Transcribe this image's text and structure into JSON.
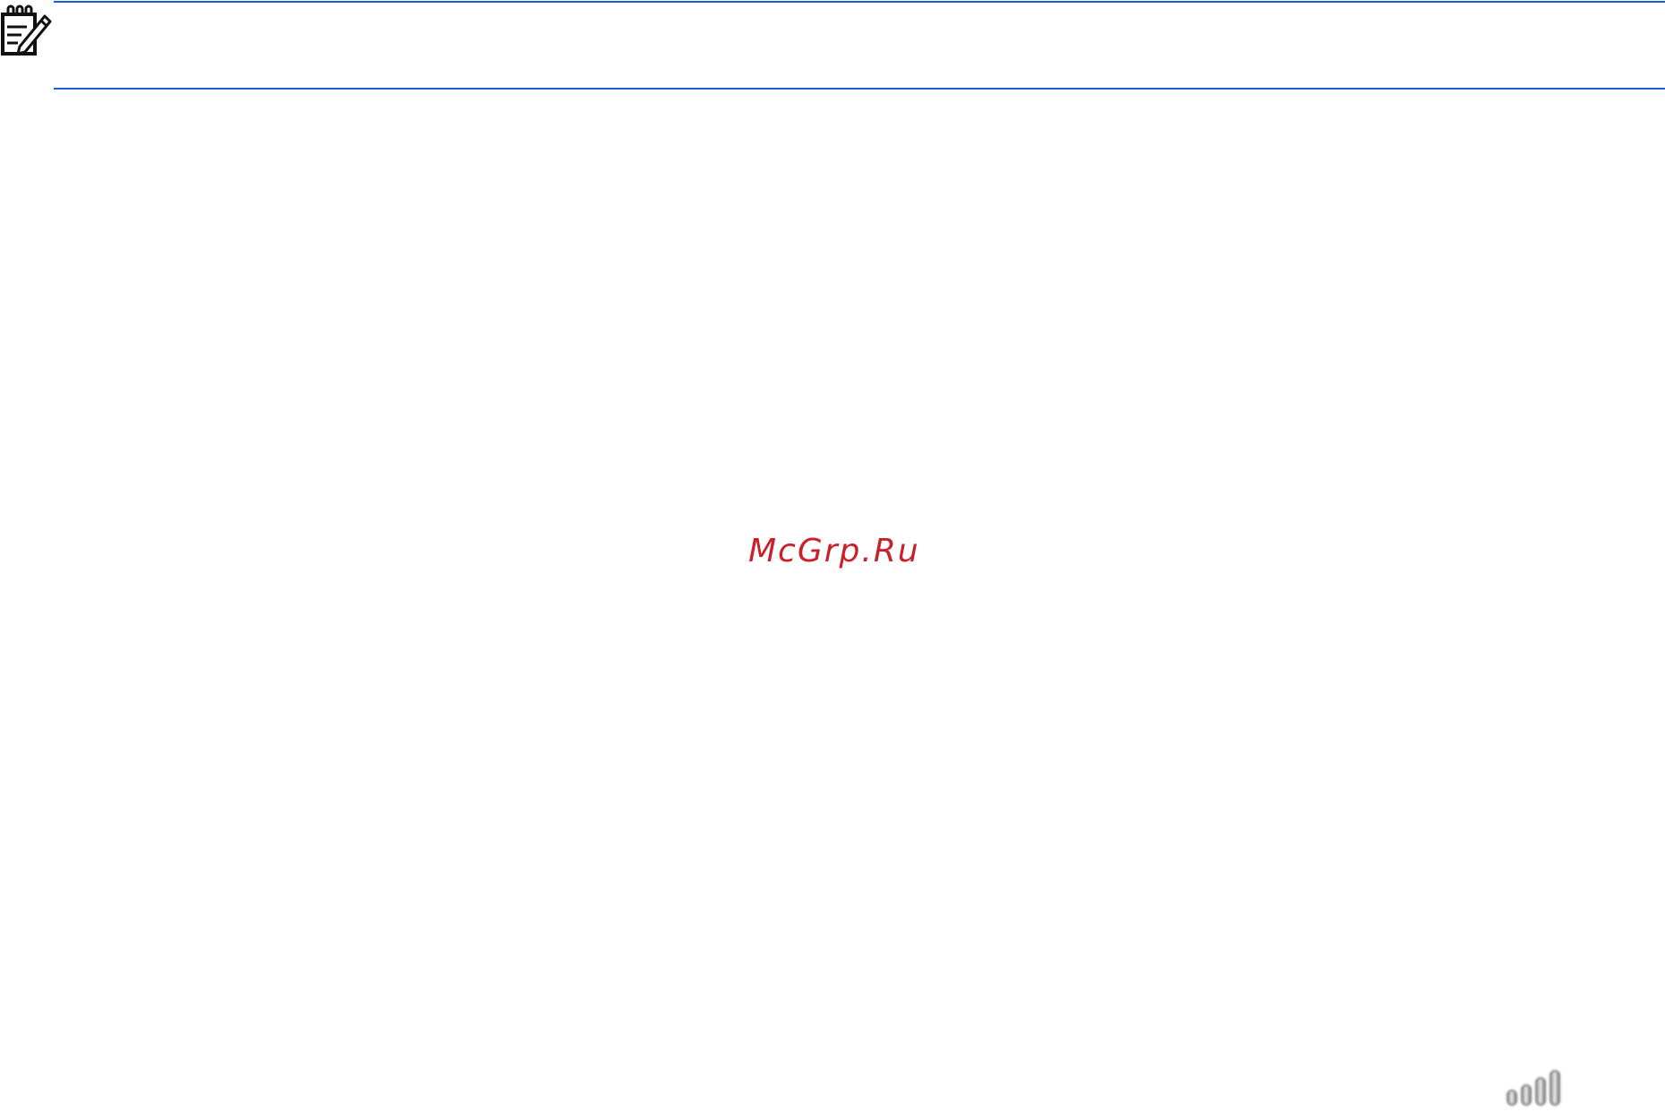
{
  "note": {
    "icon": "notepad-pencil-icon",
    "rule_color": "#1a5fd6"
  },
  "watermark": {
    "text": "McGrp.Ru",
    "color": "#c9202b"
  },
  "footer": {
    "icon": "signal-bars-icon"
  }
}
